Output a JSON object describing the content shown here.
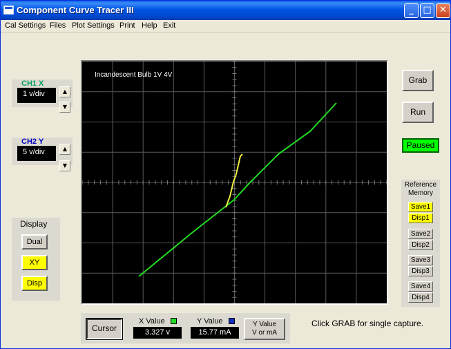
{
  "window": {
    "title": "Component Curve Tracer III"
  },
  "menu": [
    "Cal Settings",
    "Files",
    "Plot Settings",
    "Print",
    "Help",
    "Exit"
  ],
  "scope": {
    "label": "Incandescent Bulb 1V 4V"
  },
  "ch1": {
    "title": "CH1 X",
    "value": "1 v/div"
  },
  "ch2": {
    "title": "CH2 Y",
    "value": "5 v/div"
  },
  "display": {
    "title": "Display",
    "buttons": [
      "Dual",
      "XY",
      "Disp"
    ]
  },
  "controls": {
    "grab": "Grab",
    "run": "Run",
    "status": "Paused"
  },
  "reference": {
    "title_line1": "Reference",
    "title_line2": "Memory",
    "buttons": [
      "Save1",
      "Disp1",
      "Save2",
      "Disp2",
      "Save3",
      "Disp3",
      "Save4",
      "Disp4"
    ]
  },
  "bottom": {
    "cursor": "Cursor",
    "x_label": "X Value",
    "x_value": "3.327 v",
    "y_label": "Y Value",
    "y_value": "15.77 mA",
    "y_unit_line1": "Y Value",
    "y_unit_line2": "V or mA"
  },
  "hint": "Click GRAB for single capture.",
  "colors": {
    "trace_green": "#22dd22",
    "trace_yellow": "#f0f040",
    "status_green": "#00ff00",
    "highlight_yellow": "#ffff00"
  }
}
